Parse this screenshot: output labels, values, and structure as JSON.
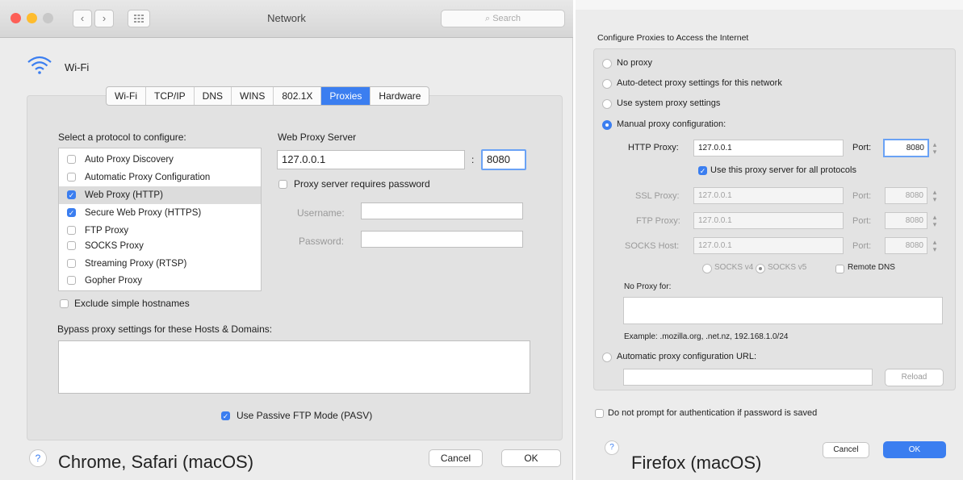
{
  "left": {
    "window_title": "Network",
    "search_placeholder": "Search",
    "interface_name": "Wi-Fi",
    "tabs": [
      {
        "label": "Wi-Fi"
      },
      {
        "label": "TCP/IP"
      },
      {
        "label": "DNS"
      },
      {
        "label": "WINS"
      },
      {
        "label": "802.1X"
      },
      {
        "label": "Proxies",
        "selected": true
      },
      {
        "label": "Hardware"
      }
    ],
    "protocol_heading": "Select a protocol to configure:",
    "protocols": [
      {
        "label": "Auto Proxy Discovery",
        "checked": false
      },
      {
        "label": "Automatic Proxy Configuration",
        "checked": false
      },
      {
        "label": "Web Proxy (HTTP)",
        "checked": true,
        "selected": true
      },
      {
        "label": "Secure Web Proxy (HTTPS)",
        "checked": true
      },
      {
        "label": "FTP Proxy",
        "checked": false
      },
      {
        "label": "SOCKS Proxy",
        "checked": false
      },
      {
        "label": "Streaming Proxy (RTSP)",
        "checked": false
      },
      {
        "label": "Gopher Proxy",
        "checked": false
      }
    ],
    "server_heading": "Web Proxy Server",
    "server_value": "127.0.0.1",
    "port_separator": ":",
    "port_value": "8080",
    "requires_password_label": "Proxy server requires password",
    "username_label": "Username:",
    "password_label": "Password:",
    "exclude_simple_label": "Exclude simple hostnames",
    "bypass_label": "Bypass proxy settings for these Hosts & Domains:",
    "passive_ftp_label": "Use Passive FTP Mode (PASV)",
    "help": "?",
    "caption": "Chrome, Safari (macOS)",
    "cancel_label": "Cancel",
    "ok_label": "OK"
  },
  "right": {
    "heading": "Configure Proxies to Access the Internet",
    "options": {
      "no_proxy": "No proxy",
      "auto_detect": "Auto-detect proxy settings for this network",
      "system": "Use system proxy settings",
      "manual": "Manual proxy configuration:"
    },
    "http_proxy_label": "HTTP Proxy:",
    "http_proxy_value": "127.0.0.1",
    "port_label": "Port:",
    "http_port_value": "8080",
    "use_for_all_label": "Use this proxy server for all protocols",
    "ssl_label": "SSL Proxy:",
    "ssl_value": "127.0.0.1",
    "ssl_port": "8080",
    "ftp_label": "FTP Proxy:",
    "ftp_value": "127.0.0.1",
    "ftp_port": "8080",
    "socks_label": "SOCKS Host:",
    "socks_value": "127.0.0.1",
    "socks_port": "8080",
    "socks_v4": "SOCKS v4",
    "socks_v5": "SOCKS v5",
    "remote_dns": "Remote DNS",
    "no_proxy_for_label": "No Proxy for:",
    "example_text": "Example: .mozilla.org, .net.nz, 192.168.1.0/24",
    "auto_config_url_label": "Automatic proxy configuration URL:",
    "reload_label": "Reload",
    "no_prompt_label": "Do not prompt for authentication if password is saved",
    "help": "?",
    "caption": "Firefox (macOS)",
    "cancel_label": "Cancel",
    "ok_label": "OK"
  },
  "colors": {
    "accent": "#3b7ef0",
    "close": "#fd5f57",
    "minimize": "#febc2e",
    "zoom": "#c8c8c8"
  }
}
